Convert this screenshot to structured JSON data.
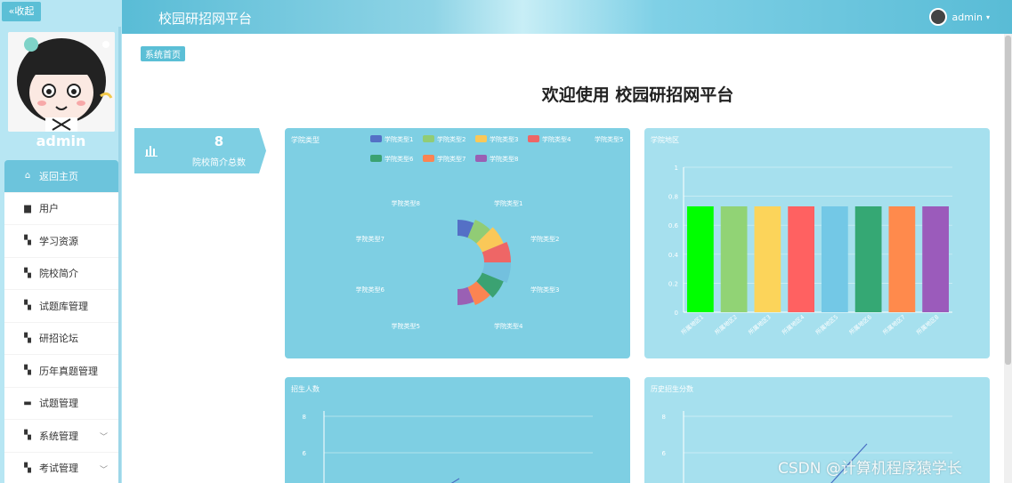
{
  "sidebar": {
    "collapse_label": "«收起",
    "user_name": "admin",
    "items": [
      {
        "label": "返回主页",
        "icon": "home-icon",
        "active": true
      },
      {
        "label": "用户",
        "icon": "user-icon"
      },
      {
        "label": "学习资源",
        "icon": "grid-icon"
      },
      {
        "label": "院校简介",
        "icon": "grid-icon"
      },
      {
        "label": "试题库管理",
        "icon": "grid-icon"
      },
      {
        "label": "研招论坛",
        "icon": "grid-icon"
      },
      {
        "label": "历年真题管理",
        "icon": "grid-icon"
      },
      {
        "label": "试题管理",
        "icon": "briefcase-icon"
      },
      {
        "label": "系统管理",
        "icon": "grid-icon",
        "expandable": true
      },
      {
        "label": "考试管理",
        "icon": "grid-icon",
        "expandable": true
      }
    ]
  },
  "header": {
    "title": "校园研招网平台",
    "user_label": "admin"
  },
  "main": {
    "breadcrumb": "系统首页",
    "welcome": "欢迎使用 校园研招网平台",
    "stat": {
      "value": "8",
      "label": "院校简介总数",
      "icon": "bar-chart-icon"
    }
  },
  "watermark": "CSDN @计算机程序猿学长",
  "chart_data": [
    {
      "type": "pie",
      "title": "学院类型",
      "categories": [
        "学院类型1",
        "学院类型2",
        "学院类型3",
        "学院类型4",
        "学院类型5",
        "学院类型6",
        "学院类型7",
        "学院类型8"
      ],
      "values": [
        1,
        1,
        1,
        1,
        1,
        1,
        1,
        1
      ],
      "colors": [
        "#5470c6",
        "#91cc75",
        "#fac858",
        "#ee6666",
        "#73c0de",
        "#3ba272",
        "#fc8452",
        "#9a60b4"
      ],
      "legend": "top"
    },
    {
      "type": "bar",
      "title": "学院地区",
      "categories": [
        "所属地区1",
        "所属地区2",
        "所属地区3",
        "所属地区4",
        "所属地区5",
        "所属地区6",
        "所属地区7",
        "所属地区8"
      ],
      "values": [
        0.73,
        0.73,
        0.73,
        0.73,
        0.73,
        0.73,
        0.73,
        0.73
      ],
      "colors": [
        "#00ff00",
        "#91d375",
        "#fcd45a",
        "#ff6161",
        "#73c8e6",
        "#35a874",
        "#ff8a4c",
        "#9b5bbb"
      ],
      "ylim": [
        0,
        1
      ],
      "yticks": [
        "0",
        "0.2",
        "0.4",
        "0.6",
        "0.8",
        "1"
      ]
    },
    {
      "type": "line",
      "title": "招生人数",
      "yticks": [
        "8",
        "6"
      ]
    },
    {
      "type": "line",
      "title": "历史招生分数",
      "yticks": [
        "8",
        "6"
      ]
    }
  ]
}
